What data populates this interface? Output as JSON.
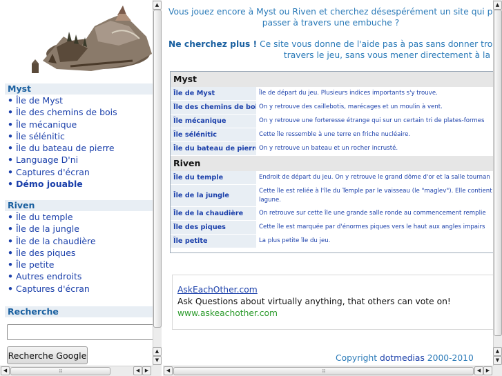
{
  "left": {
    "sections": [
      {
        "title": "Myst",
        "items": [
          {
            "label": "Île de Myst",
            "bold": false
          },
          {
            "label": "Île des chemins de bois",
            "bold": false
          },
          {
            "label": "Île mécanique",
            "bold": false
          },
          {
            "label": "Île sélénitic",
            "bold": false
          },
          {
            "label": "Île du bateau de pierre",
            "bold": false
          },
          {
            "label": "Language D'ni",
            "bold": false
          },
          {
            "label": "Captures d'écran",
            "bold": false
          },
          {
            "label": "Démo jouable",
            "bold": true
          }
        ]
      },
      {
        "title": "Riven",
        "items": [
          {
            "label": "Île du temple",
            "bold": false
          },
          {
            "label": "Île de la jungle",
            "bold": false
          },
          {
            "label": "Île de la chaudière",
            "bold": false
          },
          {
            "label": "Île des piques",
            "bold": false
          },
          {
            "label": "Île petite",
            "bold": false
          },
          {
            "label": "Autres endroits",
            "bold": false
          },
          {
            "label": "Captures d'écran",
            "bold": false
          }
        ]
      }
    ],
    "search": {
      "title": "Recherche",
      "input_value": "",
      "button_label": "Recherche Google"
    }
  },
  "right": {
    "intro_line1": "Vous jouez encore à Myst ou Riven et cherchez désespérément un site qui pour",
    "intro_line2": "passer à travers une embuche ?",
    "intro2_bold": "Ne cherchez plus !",
    "intro2_line1": "Ce site vous donne de l'aide pas à pas sans donner trop d",
    "intro2_line2": "travers le jeu, sans vous mener directement à la",
    "guide": [
      {
        "title": "Myst",
        "rows": [
          {
            "name": "Île de Myst",
            "desc": "Île de départ du jeu. Plusieurs indices importants s'y trouve."
          },
          {
            "name": "Île des chemins de bois",
            "desc": "On y retrouve des caillebotis, marécages et un moulin à vent."
          },
          {
            "name": "Île mécanique",
            "desc": "On y retrouve une forteresse étrange qui sur un certain tri de plates-formes"
          },
          {
            "name": "Île sélénitic",
            "desc": "Cette île ressemble à une terre en friche nucléaire."
          },
          {
            "name": "Île du bateau de pierre",
            "desc": "On y retrouve un bateau et un rocher incrusté."
          }
        ]
      },
      {
        "title": "Riven",
        "rows": [
          {
            "name": "Île du temple",
            "desc": "Endroit de départ du jeu. On y retrouve le grand dôme d'or et la salle tournan"
          },
          {
            "name": "Île de la jungle",
            "desc": "Cette île est reliée à l'île du Temple par le vaisseau (le \"maglev\"). Elle contient lagune.",
            "tall": true
          },
          {
            "name": "Île de la chaudière",
            "desc": "On retrouve sur cette île une grande salle ronde au commencement remplie"
          },
          {
            "name": "Île des piques",
            "desc": "Cette île est marquée par d'énormes piques vers le haut aux angles impairs"
          },
          {
            "name": "Île petite",
            "desc": "La plus petite île du jeu."
          }
        ]
      }
    ],
    "ad": {
      "title": "AskEachOther.com",
      "text": "Ask Questions about virtually anything, that others can vote on!",
      "url": "www.askeachother.com"
    },
    "copyright_prefix": "Copyright",
    "copyright_link": "dotmedias",
    "copyright_years": "2000-2010"
  },
  "colors": {
    "accent": "#1a60a0",
    "link": "#1a3faa",
    "intro_text": "#2a7ab8",
    "section_bg": "#e8eef4",
    "ad_url": "#2a9a2a"
  },
  "icons": {
    "scroll_up": "▲",
    "scroll_down": "▼",
    "scroll_left": "◀",
    "scroll_right": "▶"
  }
}
